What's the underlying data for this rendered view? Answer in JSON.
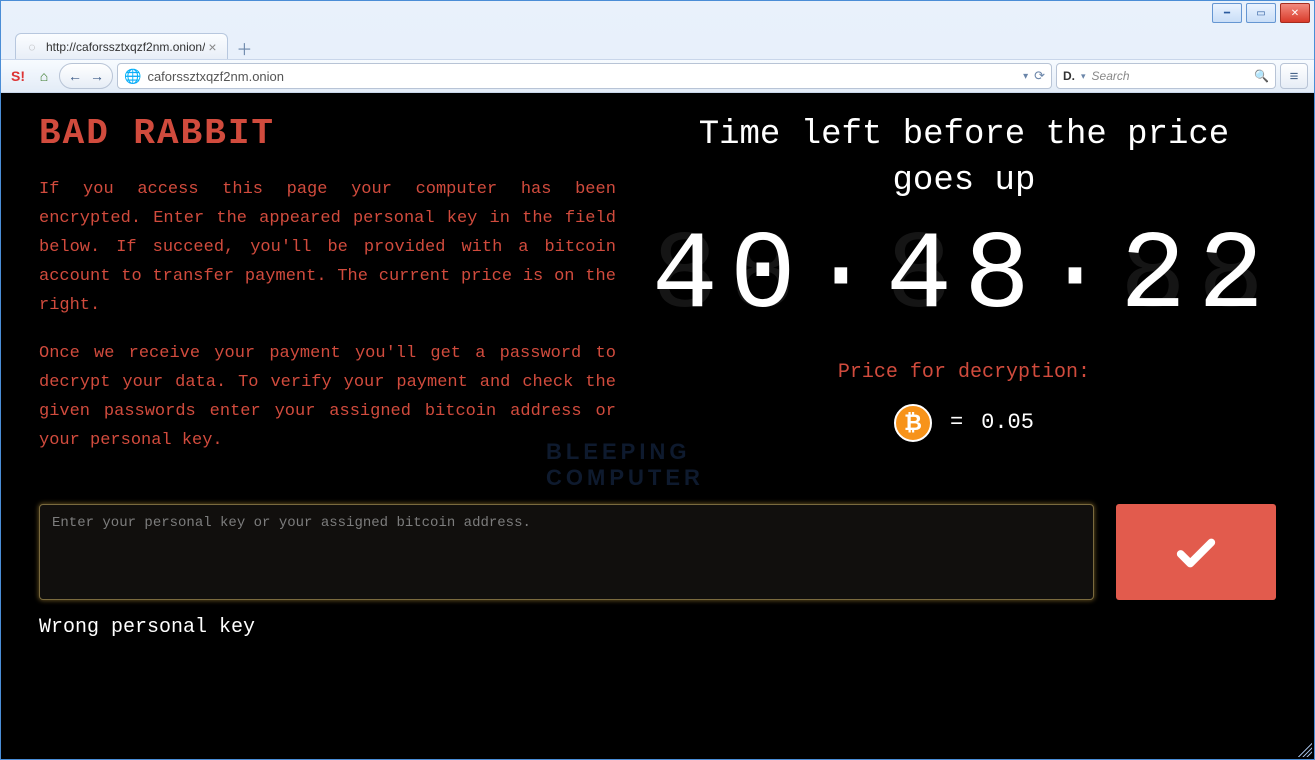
{
  "browser": {
    "tab_title": "http://caforssztxqzf2nm.onion/",
    "url": "caforssztxqzf2nm.onion",
    "search_placeholder": "Search",
    "search_engine": "D."
  },
  "page": {
    "title": "BAD RABBIT",
    "paragraph1": "If you access this page your computer has been encrypted. Enter the appeared personal key in the field below. If succeed, you'll be provided with a bitcoin account to transfer payment. The current price is on the right.",
    "paragraph2": "Once we receive your payment you'll get a password to decrypt your data. To verify your payment and check the given passwords enter your assigned bitcoin address or your personal key.",
    "timer_label": "Time left before the price goes up",
    "timer_ghost": "88·88·88",
    "timer_value": "40·48·22",
    "price_label": "Price for decryption:",
    "price_currency_symbol": "₿",
    "price_equals": "=",
    "price_amount": "0.05",
    "input_placeholder": "Enter your personal key or your assigned bitcoin address.",
    "error": "Wrong personal key",
    "watermark_line1": "BLEEPING",
    "watermark_line2": "COMPUTER"
  }
}
